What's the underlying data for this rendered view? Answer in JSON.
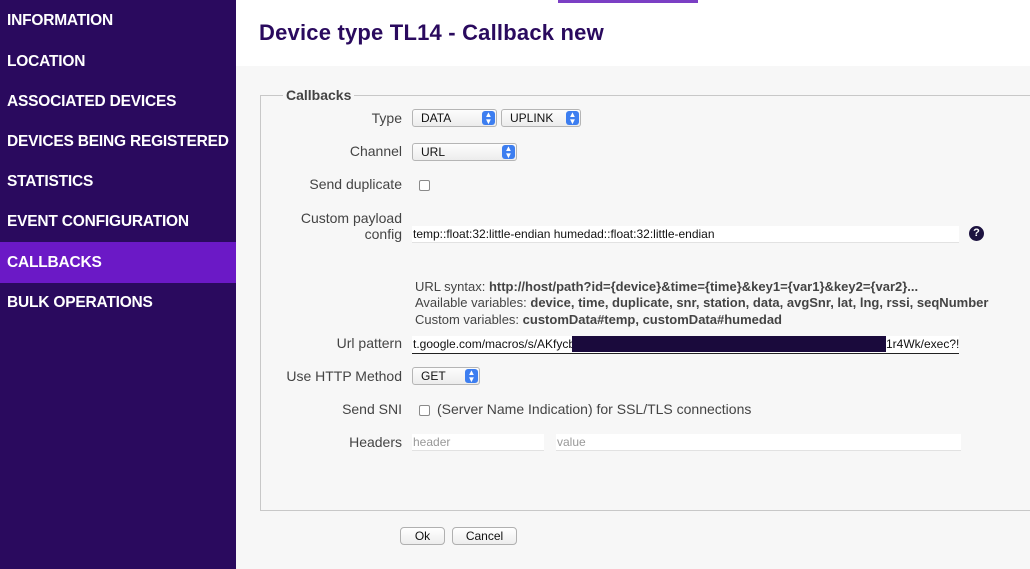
{
  "sidebar": {
    "items": [
      {
        "label": "INFORMATION"
      },
      {
        "label": "LOCATION"
      },
      {
        "label": "ASSOCIATED DEVICES"
      },
      {
        "label": "DEVICES BEING REGISTERED"
      },
      {
        "label": "STATISTICS"
      },
      {
        "label": "EVENT CONFIGURATION"
      },
      {
        "label": "CALLBACKS"
      },
      {
        "label": "BULK OPERATIONS"
      }
    ],
    "active": "CALLBACKS"
  },
  "header": {
    "title": "Device type TL14 - Callback new"
  },
  "form": {
    "legend": "Callbacks",
    "type": {
      "label": "Type",
      "value1": "DATA",
      "value2": "UPLINK"
    },
    "channel": {
      "label": "Channel",
      "value": "URL"
    },
    "send_duplicate": {
      "label": "Send duplicate",
      "checked": false
    },
    "custom_payload": {
      "label_line1": "Custom payload",
      "label_line2": "config",
      "value": "temp::float:32:little-endian humedad::float:32:little-endian"
    },
    "help_icon": "question-icon",
    "url_syntax": {
      "prefix": "URL syntax: ",
      "value": "http://host/path?id={device}&time={time}&key1={var1}&key2={var2}..."
    },
    "available_variables": {
      "prefix": "Available variables: ",
      "value": "device, time, duplicate, snr, station, data, avgSnr, lat, lng, rssi, seqNumber"
    },
    "custom_variables": {
      "prefix": "Custom variables: ",
      "value": "customData#temp, customData#humedad"
    },
    "url_pattern": {
      "label": "Url pattern",
      "value_start": "t.google.com/macros/s/AKfycb",
      "value_end": "1r4Wk/exec?!"
    },
    "http_method": {
      "label": "Use HTTP Method",
      "value": "GET"
    },
    "send_sni": {
      "label": "Send SNI",
      "text": "(Server Name Indication) for SSL/TLS connections",
      "checked": false
    },
    "headers": {
      "label": "Headers",
      "header_placeholder": "header",
      "value_placeholder": "value"
    }
  },
  "buttons": {
    "ok": "Ok",
    "cancel": "Cancel"
  },
  "colors": {
    "sidebar_bg": "#2a0a5e",
    "active_item": "#6b19c6",
    "title": "#2a0a5e"
  }
}
